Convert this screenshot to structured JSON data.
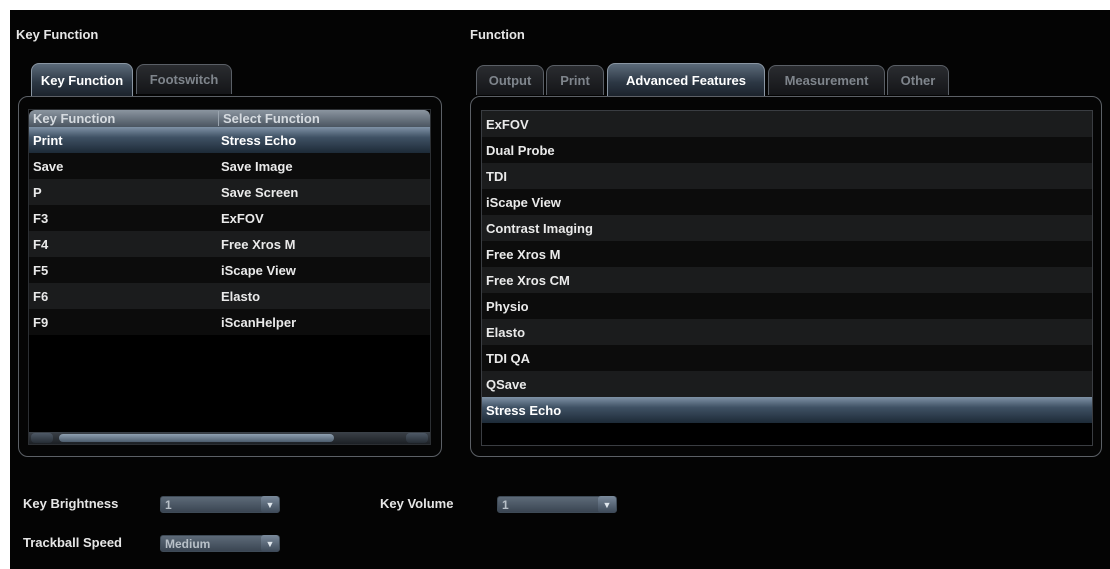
{
  "left": {
    "title": "Key Function",
    "tabs": [
      "Key Function",
      "Footswitch"
    ],
    "columns": [
      "Key Function",
      "Select Function"
    ],
    "rows": [
      {
        "key": "Print",
        "func": "Stress Echo"
      },
      {
        "key": "Save",
        "func": "Save Image"
      },
      {
        "key": "P",
        "func": "Save Screen"
      },
      {
        "key": "F3",
        "func": "ExFOV"
      },
      {
        "key": "F4",
        "func": "Free Xros M"
      },
      {
        "key": "F5",
        "func": "iScape View"
      },
      {
        "key": "F6",
        "func": "Elasto"
      },
      {
        "key": "F9",
        "func": "iScanHelper"
      }
    ],
    "selected_row": 0
  },
  "right": {
    "title": "Function",
    "tabs": [
      "Output",
      "Print",
      "Advanced Features",
      "Measurement",
      "Other"
    ],
    "active_tab": 2,
    "items": [
      "ExFOV",
      "Dual Probe",
      "TDI",
      "iScape View",
      "Contrast Imaging",
      "Free Xros M",
      "Free Xros CM",
      "Physio",
      "Elasto",
      "TDI QA",
      "QSave",
      "Stress Echo"
    ],
    "selected_item": 11
  },
  "bottom": {
    "key_brightness_label": "Key Brightness",
    "key_brightness_value": "1",
    "key_volume_label": "Key Volume",
    "key_volume_value": "1",
    "trackball_speed_label": "Trackball Speed",
    "trackball_speed_value": "Medium"
  },
  "colors": {
    "background": "#040404",
    "selection": "#3f5164",
    "text": "#eaeaea"
  }
}
